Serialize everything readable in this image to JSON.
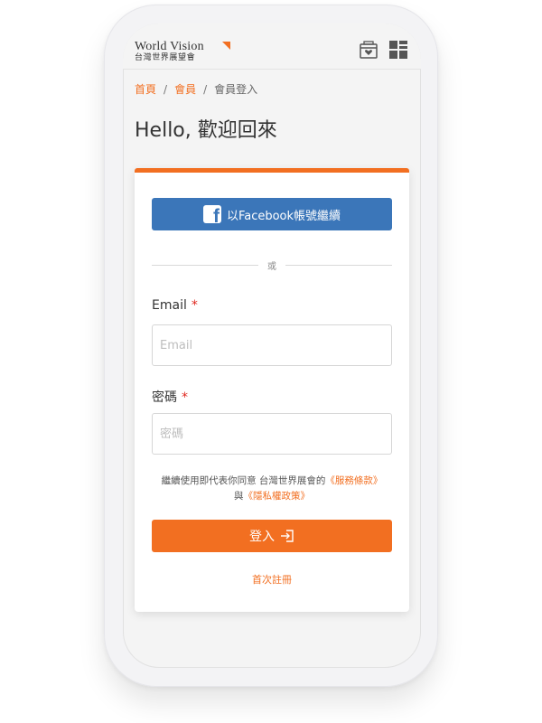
{
  "header": {
    "logo_en": "World Vision",
    "logo_zh": "台灣世界展望會",
    "gift_icon": "gift-box-heart-icon",
    "menu_icon": "grid-menu-icon"
  },
  "breadcrumb": {
    "items": [
      "首頁",
      "會員",
      "會員登入"
    ],
    "separator": "/"
  },
  "page": {
    "title": "Hello, 歡迎回來"
  },
  "login": {
    "facebook_label": "以Facebook帳號繼續",
    "divider_text": "或",
    "email_label": "Email",
    "email_placeholder": "Email",
    "email_value": "",
    "password_label": "密碼",
    "password_placeholder": "密碼",
    "password_value": "",
    "required_mark": "*",
    "terms_text": "繼續使用即代表你同意 台灣世界展會的",
    "terms_link": "《服務條款》",
    "terms_and": "與",
    "privacy_link": "《隱私權政策》",
    "submit_label": "登入",
    "register_link": "首次註冊"
  },
  "colors": {
    "accent": "#f26f21",
    "facebook": "#3b76b9",
    "required": "#e0281f"
  }
}
